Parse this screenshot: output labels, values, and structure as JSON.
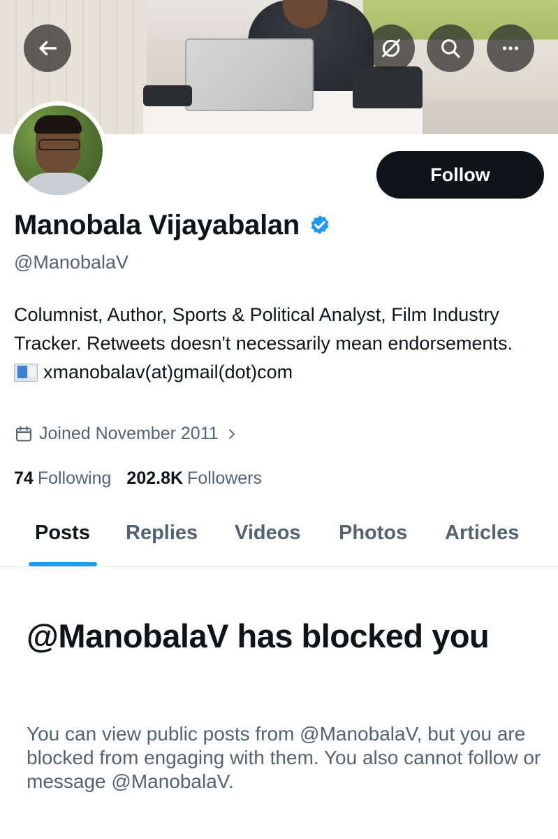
{
  "profile": {
    "display_name": "Manobala Vijayabalan",
    "handle": "@ManobalaV",
    "bio_line1": "Columnist, Author, Sports & Political Analyst, Film Industry Tracker. Retweets doesn't necessarily mean endorsements.",
    "email": "xmanobalav(at)gmail(dot)com",
    "joined": "Joined November 2011",
    "following_count": "74",
    "following_label": "Following",
    "followers_count": "202.8K",
    "followers_label": "Followers",
    "verified": true
  },
  "actions": {
    "follow_label": "Follow"
  },
  "tabs": [
    {
      "label": "Posts",
      "active": true
    },
    {
      "label": "Replies",
      "active": false
    },
    {
      "label": "Videos",
      "active": false
    },
    {
      "label": "Photos",
      "active": false
    },
    {
      "label": "Articles",
      "active": false
    }
  ],
  "blocked": {
    "title": "@ManobalaV has blocked you",
    "message": "You can view public posts from @ManobalaV, but you are blocked from engaging with them. You also cannot follow or message @ManobalaV."
  },
  "icons": {
    "back": "arrow-left-icon",
    "grok": "slashed-circle-icon",
    "search": "search-icon",
    "more": "more-horizontal-icon",
    "verified": "verified-badge-icon",
    "calendar": "calendar-icon"
  },
  "colors": {
    "accent": "#1d9bf0",
    "text_primary": "#0f1419",
    "text_secondary": "#536471",
    "button_dark": "#0f1419"
  }
}
